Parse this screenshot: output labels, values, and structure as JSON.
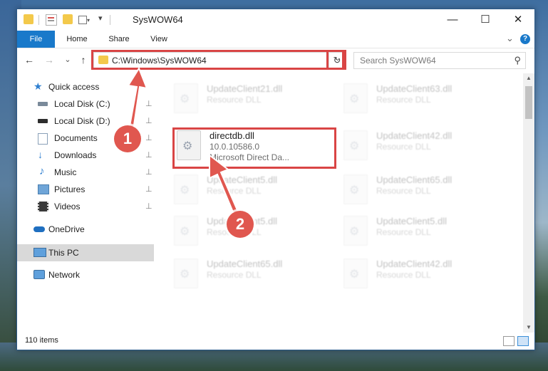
{
  "window": {
    "title": "SysWOW64",
    "minimize_glyph": "—",
    "maximize_glyph": "☐",
    "close_glyph": "✕"
  },
  "ribbon": {
    "tabs": [
      "File",
      "Home",
      "Share",
      "View"
    ],
    "expand_glyph": "⌄",
    "help_glyph": "?"
  },
  "navigation": {
    "back_glyph": "←",
    "forward_glyph": "→",
    "recent_glyph": "⌄",
    "up_glyph": "↑",
    "address": "C:\\Windows\\SysWOW64",
    "refresh_glyph": "↻",
    "search_placeholder": "Search SysWOW64",
    "search_icon": "⚲"
  },
  "sidebar": {
    "items": [
      {
        "label": "Quick access",
        "icon": "star-icon",
        "pinned": false
      },
      {
        "label": "Local Disk (C:)",
        "icon": "drive-icon",
        "pinned": true
      },
      {
        "label": "Local Disk (D:)",
        "icon": "drive-icon",
        "pinned": true
      },
      {
        "label": "Documents",
        "icon": "documents-icon",
        "pinned": true
      },
      {
        "label": "Downloads",
        "icon": "download-icon",
        "pinned": true
      },
      {
        "label": "Music",
        "icon": "music-icon",
        "pinned": true
      },
      {
        "label": "Pictures",
        "icon": "pictures-icon",
        "pinned": true
      },
      {
        "label": "Videos",
        "icon": "videos-icon",
        "pinned": true
      },
      {
        "label": "OneDrive",
        "icon": "cloud-icon",
        "pinned": false
      },
      {
        "label": "This PC",
        "icon": "computer-icon",
        "pinned": false,
        "selected": true
      },
      {
        "label": "Network",
        "icon": "network-icon",
        "pinned": false
      }
    ],
    "pin_glyph": "📌"
  },
  "files": {
    "highlighted": {
      "name": "directdb.dll",
      "version": "10.0.10586.0",
      "description": "Microsoft Direct Da..."
    },
    "background": [
      {
        "name": "UpdateClient21.dll",
        "type": "Resource DLL"
      },
      {
        "name": "UpdateClient63.dll",
        "type": "Resource DLL"
      },
      {
        "name": "UpdateClient42.dll",
        "type": "Resource DLL"
      },
      {
        "name": "UpdateClient5.dll",
        "type": "Resource DLL"
      },
      {
        "name": "UpdateClient65.dll",
        "type": "Resource DLL"
      },
      {
        "name": "UpdateClient5.dll",
        "type": "Resource DLL"
      },
      {
        "name": "UpdateClient5.dll",
        "type": "Resource DLL"
      },
      {
        "name": "UpdateClient65.dll",
        "type": "Resource DLL"
      },
      {
        "name": "UpdateClient42.dll",
        "type": "Resource DLL"
      }
    ]
  },
  "status": {
    "item_count": "110 items"
  },
  "callouts": {
    "one": "1",
    "two": "2"
  },
  "colors": {
    "accent": "#1979ca",
    "highlight_border": "#d94545",
    "callout": "#e0574f"
  }
}
